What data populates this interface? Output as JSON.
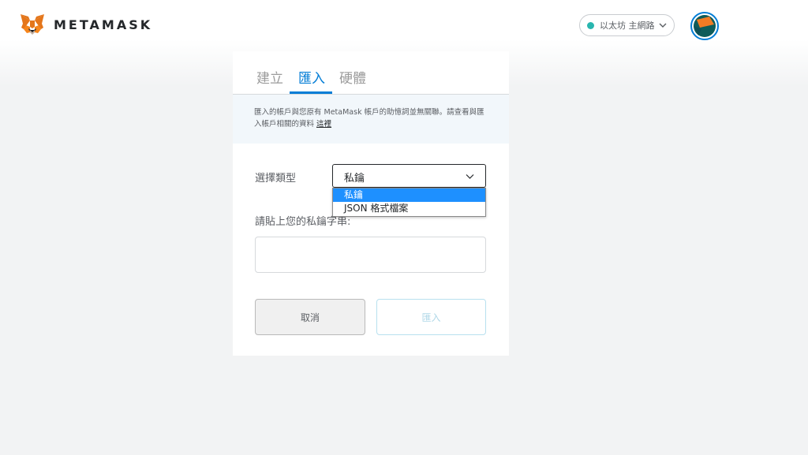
{
  "header": {
    "brand": "METAMASK",
    "network_label": "以太坊 主網路",
    "network_color": "#29b6af"
  },
  "tabs": [
    {
      "label": "建立",
      "active": false
    },
    {
      "label": "匯入",
      "active": true
    },
    {
      "label": "硬體",
      "active": false
    }
  ],
  "notice": {
    "text": "匯入的帳戶與您原有 MetaMask 帳戶的助憶詞並無關聯。請查看與匯入帳戶相關的資料",
    "link": "這裡"
  },
  "form": {
    "type_label": "選擇類型",
    "selected_type": "私鑰",
    "options": [
      "私鑰",
      "JSON 格式檔案"
    ],
    "paste_label": "請貼上您的私鑰字串:",
    "key_value": ""
  },
  "buttons": {
    "cancel": "取消",
    "import": "匯入"
  },
  "colors": {
    "accent": "#037dd6",
    "selected_option": "#1e90ff"
  }
}
